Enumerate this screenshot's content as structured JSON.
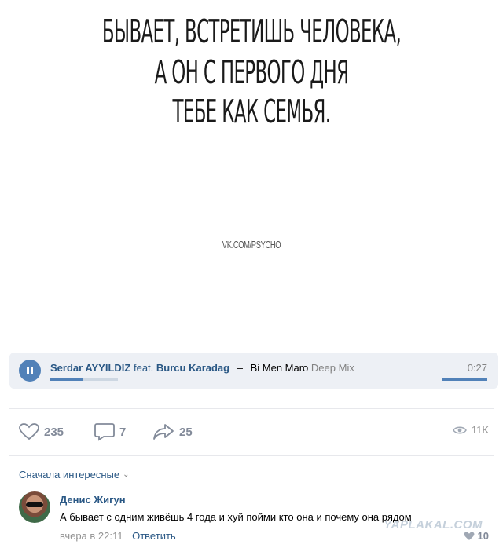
{
  "post": {
    "quote_lines": [
      "БЫВАЕТ, ВСТРЕТИШЬ ЧЕЛОВЕКА,",
      "А ОН С ПЕРВОГО ДНЯ",
      "ТЕБЕ КАК СЕМЬЯ."
    ],
    "watermark": "VK.COM/PSYCHO"
  },
  "audio": {
    "artist": "Serdar AYYILDIZ",
    "feat_label": "feat.",
    "feat_artist": "Burcu Karadag",
    "separator": "–",
    "title": "Bi Men Maro",
    "subtitle": "Deep Mix",
    "duration": "0:27",
    "progress": 0.49,
    "accent_color": "#5181b8"
  },
  "actions": {
    "likes": "235",
    "comments": "7",
    "shares": "25",
    "views": "11K"
  },
  "comments": {
    "sort_label": "Сначала интересные",
    "items": [
      {
        "author": "Денис Жигун",
        "text": "А бывает с одним живёшь 4 года и хуй пойми кто она и почему она рядом",
        "time": "вчера в 22:11",
        "reply_label": "Ответить",
        "likes": "10"
      }
    ]
  },
  "site_watermark": "YAPLAKAL.COM"
}
